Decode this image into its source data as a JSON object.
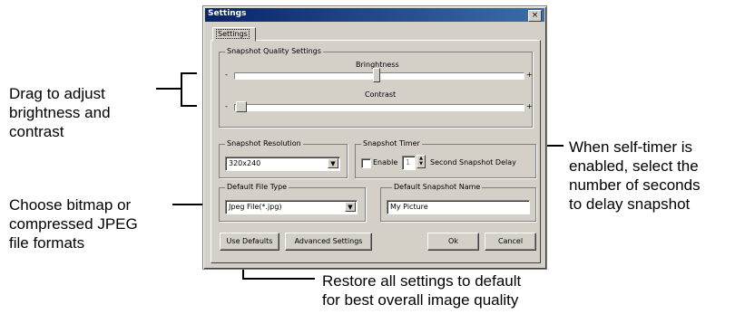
{
  "window": {
    "title": "Settings",
    "close_glyph": "×"
  },
  "tab": {
    "label": "Settings"
  },
  "quality": {
    "legend": "Snapshot Quality Settings",
    "brightness_label": "Bringhtness",
    "contrast_label": "Contrast",
    "minus": "-",
    "plus": "+",
    "brightness_level": 0.5,
    "contrast_level": 0.05
  },
  "resolution": {
    "legend": "Snapshot Resolution",
    "value": "320x240"
  },
  "timer": {
    "legend": "Snapshot Timer",
    "enable_label": "Enable",
    "seconds": "1",
    "delay_label": "Second Snapshot Delay",
    "enabled": false
  },
  "file_type": {
    "legend": "Default File Type",
    "value": "Jpeg File(*.jpg)"
  },
  "snapshot_name": {
    "legend": "Default Snapshot Name",
    "value": "My Picture"
  },
  "buttons": {
    "use_defaults": "Use Defaults",
    "advanced": "Advanced Settings",
    "ok": "Ok",
    "cancel": "Cancel"
  },
  "callouts": {
    "brightness": [
      "Drag to adjust",
      "brightness and",
      "contrast"
    ],
    "timer": [
      "When self-timer is",
      "enabled, select the",
      "number of seconds",
      "to delay snapshot"
    ],
    "file_type": [
      "Choose bitmap or",
      "compressed JPEG",
      "file formats"
    ],
    "defaults": [
      "Restore all settings to default",
      "for best overall image quality"
    ]
  },
  "icons": {
    "dropdown": "chevron-down-icon",
    "spin": "spin-arrows-icon",
    "close": "close-icon"
  }
}
